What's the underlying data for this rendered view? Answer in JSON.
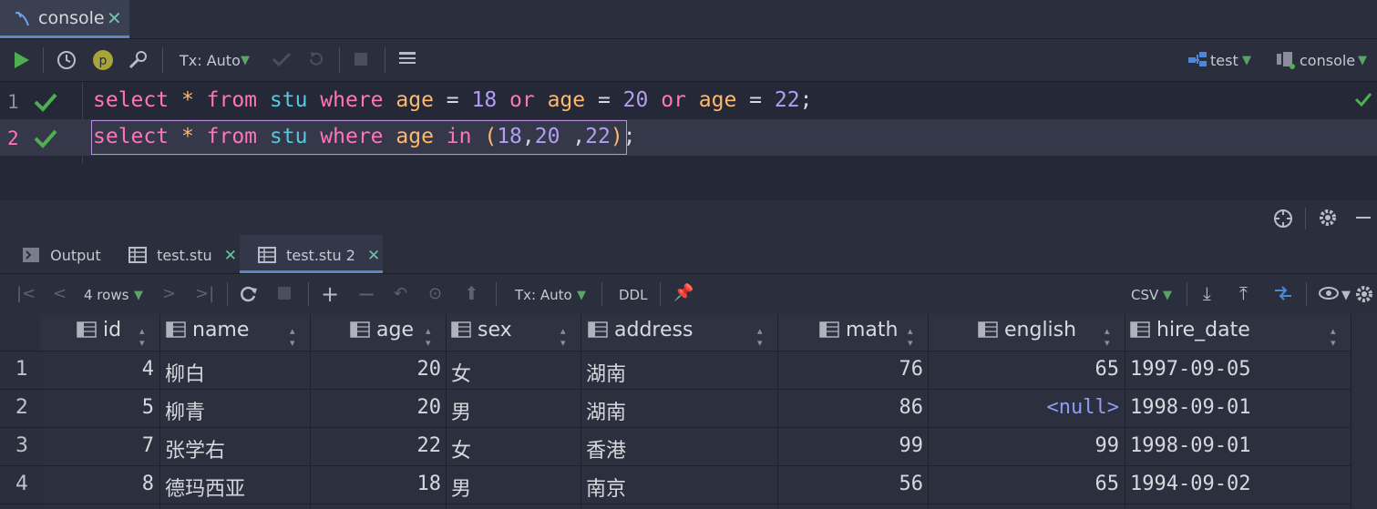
{
  "tab": {
    "label": "console",
    "close": "✕"
  },
  "toolbar": {
    "tx_mode": "Tx: Auto",
    "datasource": "test",
    "session": "console"
  },
  "editor": {
    "line_numbers": [
      "1",
      "2"
    ],
    "line1": {
      "t1": "select",
      "t2": " * ",
      "t3": "from",
      "t4": " stu ",
      "t5": "where",
      "t6": " age ",
      "t7": "= ",
      "t8": "18",
      "t9": " or ",
      "t10": "age",
      "t11": " = ",
      "t12": "20",
      "t13": " or ",
      "t14": "age",
      "t15": " = ",
      "t16": "22",
      "t17": ";"
    },
    "line2": {
      "t1": "select",
      "t2": " * ",
      "t3": "from",
      "t4": " stu ",
      "t5": "where",
      "t6": " age ",
      "t7": "in",
      "t8": " (",
      "t9": "18",
      "t10": ",",
      "t11": "20",
      "t12": " ,",
      "t13": "22",
      "t14": ")",
      "t15": ";"
    }
  },
  "results": {
    "tabs": [
      {
        "label": "Output"
      },
      {
        "label": "test.stu",
        "close": "✕"
      },
      {
        "label": "test.stu 2",
        "close": "✕"
      }
    ],
    "rows_label": "4 rows",
    "tx_mode": "Tx: Auto",
    "ddl": "DDL",
    "export": "CSV",
    "columns": [
      "id",
      "name",
      "age",
      "sex",
      "address",
      "math",
      "english",
      "hire_date"
    ],
    "rows": [
      {
        "n": "1",
        "id": "4",
        "name": "柳白",
        "age": "20",
        "sex": "女",
        "address": "湖南",
        "math": "76",
        "english": "65",
        "hire_date": "1997-09-05"
      },
      {
        "n": "2",
        "id": "5",
        "name": "柳青",
        "age": "20",
        "sex": "男",
        "address": "湖南",
        "math": "86",
        "english": "<null>",
        "hire_date": "1998-09-01"
      },
      {
        "n": "3",
        "id": "7",
        "name": "张学右",
        "age": "22",
        "sex": "女",
        "address": "香港",
        "math": "99",
        "english": "99",
        "hire_date": "1998-09-01"
      },
      {
        "n": "4",
        "id": "8",
        "name": "德玛西亚",
        "age": "18",
        "sex": "男",
        "address": "南京",
        "math": "56",
        "english": "65",
        "hire_date": "1994-09-02"
      }
    ]
  },
  "colors": {
    "accent": "#5a87c5",
    "keyword": "#ff75b5",
    "number": "#b39df3",
    "run": "#4caf50"
  }
}
